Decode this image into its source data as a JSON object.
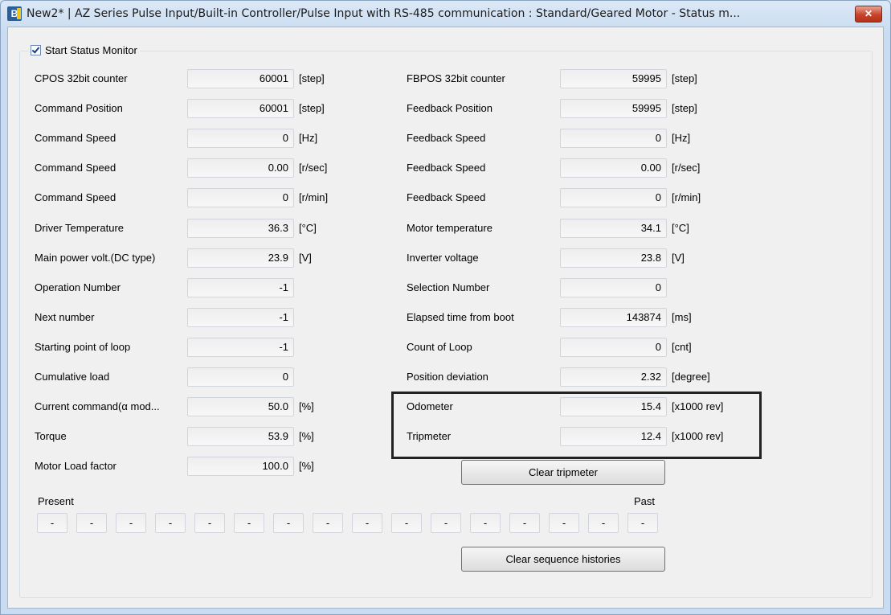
{
  "window": {
    "title": "New2* | AZ Series Pulse Input/Built-in Controller/Pulse Input with RS-485 communication : Standard/Geared Motor - Status m...",
    "close_label": "✕"
  },
  "monitor": {
    "checkbox_label": "Start Status Monitor",
    "checked": true
  },
  "left_rows": [
    {
      "label": "CPOS 32bit counter",
      "value": "60001",
      "unit": "[step]"
    },
    {
      "label": "Command Position",
      "value": "60001",
      "unit": "[step]"
    },
    {
      "label": "Command Speed",
      "value": "0",
      "unit": "[Hz]"
    },
    {
      "label": "Command Speed",
      "value": "0.00",
      "unit": "[r/sec]"
    },
    {
      "label": "Command Speed",
      "value": "0",
      "unit": "[r/min]"
    },
    {
      "label": "Driver Temperature",
      "value": "36.3",
      "unit": "[°C]"
    },
    {
      "label": "Main power volt.(DC type)",
      "value": "23.9",
      "unit": "[V]"
    },
    {
      "label": "Operation Number",
      "value": "-1",
      "unit": ""
    },
    {
      "label": "Next number",
      "value": "-1",
      "unit": ""
    },
    {
      "label": "Starting point of loop",
      "value": "-1",
      "unit": ""
    },
    {
      "label": "Cumulative load",
      "value": "0",
      "unit": ""
    },
    {
      "label": "Current  command(α mod...",
      "value": "50.0",
      "unit": "[%]"
    },
    {
      "label": "Torque",
      "value": "53.9",
      "unit": "[%]"
    },
    {
      "label": "Motor Load factor",
      "value": "100.0",
      "unit": "[%]"
    }
  ],
  "right_rows": [
    {
      "label": "FBPOS 32bit counter",
      "value": "59995",
      "unit": "[step]"
    },
    {
      "label": "Feedback Position",
      "value": "59995",
      "unit": "[step]"
    },
    {
      "label": "Feedback Speed",
      "value": "0",
      "unit": "[Hz]"
    },
    {
      "label": "Feedback Speed",
      "value": "0.00",
      "unit": "[r/sec]"
    },
    {
      "label": "Feedback Speed",
      "value": "0",
      "unit": "[r/min]"
    },
    {
      "label": "Motor temperature",
      "value": "34.1",
      "unit": "[°C]"
    },
    {
      "label": "Inverter voltage",
      "value": "23.8",
      "unit": "[V]"
    },
    {
      "label": "Selection Number",
      "value": "0",
      "unit": ""
    },
    {
      "label": "Elapsed time from boot",
      "value": "143874",
      "unit": "[ms]"
    },
    {
      "label": "Count of Loop",
      "value": "0",
      "unit": "[cnt]"
    },
    {
      "label": "Position deviation",
      "value": "2.32",
      "unit": "[degree]"
    },
    {
      "label": "Odometer",
      "value": "15.4",
      "unit": "[x1000 rev]"
    },
    {
      "label": "Tripmeter",
      "value": "12.4",
      "unit": "[x1000 rev]"
    }
  ],
  "buttons": {
    "clear_tripmeter": "Clear tripmeter",
    "clear_sequence_histories": "Clear sequence histories"
  },
  "history": {
    "present_label": "Present",
    "past_label": "Past",
    "values": [
      "-",
      "-",
      "-",
      "-",
      "-",
      "-",
      "-",
      "-",
      "-",
      "-",
      "-",
      "-",
      "-",
      "-",
      "-",
      "-"
    ]
  }
}
